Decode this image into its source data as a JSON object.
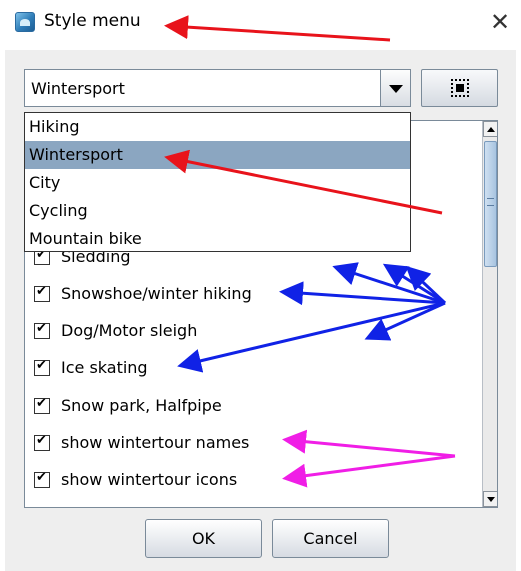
{
  "window": {
    "title": "Style menu",
    "close_glyph": "✕",
    "icon": "app-icon"
  },
  "combo": {
    "value": "Wintersport",
    "arrow_icon": "chevron-down-icon"
  },
  "frame_button": {
    "icon": "frame-select-icon"
  },
  "dropdown": {
    "items": [
      {
        "label": "Hiking",
        "selected": false
      },
      {
        "label": "Wintersport",
        "selected": true
      },
      {
        "label": "City",
        "selected": false
      },
      {
        "label": "Cycling",
        "selected": false
      },
      {
        "label": "Mountain bike",
        "selected": false
      }
    ]
  },
  "options": [
    {
      "label": "Sledding",
      "checked": true
    },
    {
      "label": "Snowshoe/winter hiking",
      "checked": true
    },
    {
      "label": "Dog/Motor sleigh",
      "checked": true
    },
    {
      "label": "Ice skating",
      "checked": true
    },
    {
      "label": "Snow park, Halfpipe",
      "checked": true
    },
    {
      "label": "show wintertour names",
      "checked": true
    },
    {
      "label": "show wintertour icons",
      "checked": true
    }
  ],
  "buttons": {
    "ok": "OK",
    "cancel": "Cancel"
  },
  "annotation_colors": {
    "red": "#e8131b",
    "blue": "#1022e6",
    "magenta": "#f01ee6"
  }
}
